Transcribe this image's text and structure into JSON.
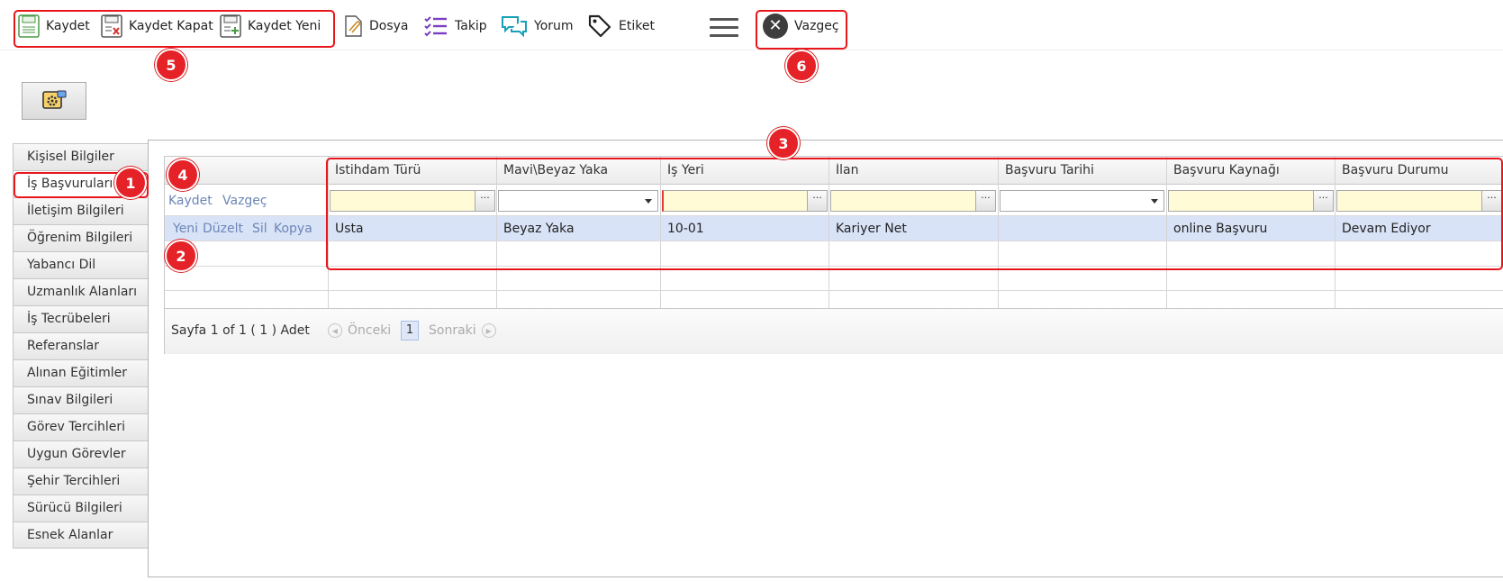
{
  "toolbar": {
    "save": "Kaydet",
    "save_close": "Kaydet Kapat",
    "save_new": "Kaydet Yeni",
    "file": "Dosya",
    "follow": "Takip",
    "comment": "Yorum",
    "tag": "Etiket",
    "cancel": "Vazgeç"
  },
  "sidebar": {
    "items": [
      {
        "label": "Kişisel Bilgiler"
      },
      {
        "label": "İş Başvuruları"
      },
      {
        "label": "İletişim Bilgileri"
      },
      {
        "label": "Öğrenim Bilgileri"
      },
      {
        "label": "Yabancı Dil"
      },
      {
        "label": "Uzmanlık Alanları"
      },
      {
        "label": "İş Tecrübeleri"
      },
      {
        "label": "Referanslar"
      },
      {
        "label": "Alınan Eğitimler"
      },
      {
        "label": "Sınav Bilgileri"
      },
      {
        "label": "Görev Tercihleri"
      },
      {
        "label": "Uygun Görevler"
      },
      {
        "label": "Şehir Tercihleri"
      },
      {
        "label": "Sürücü Bilgileri"
      },
      {
        "label": "Esnek Alanlar"
      }
    ],
    "active_index": 1
  },
  "grid": {
    "columns": [
      "İstihdam Türü",
      "Mavi\\Beyaz Yaka",
      "İş Yeri",
      "İlan",
      "Başvuru Tarihi",
      "Başvuru Kaynağı",
      "Başvuru Durumu"
    ],
    "edit_actions": {
      "save": "Kaydet",
      "cancel": "Vazgeç"
    },
    "row_actions": {
      "new": "Yeni",
      "edit": "Düzelt",
      "delete": "Sil",
      "copy": "Kopya"
    },
    "rows": [
      [
        "Usta",
        "Beyaz Yaka",
        "10-01",
        "Kariyer Net",
        "",
        "online Başvuru",
        "Devam Ediyor"
      ]
    ],
    "ellipsis": "···"
  },
  "pager": {
    "info": "Sayfa 1 of 1 ( 1 ) Adet",
    "prev": "Önceki",
    "page": "1",
    "next": "Sonraki"
  },
  "badges": {
    "b1": "1",
    "b2": "2",
    "b3": "3",
    "b4": "4",
    "b5": "5",
    "b6": "6"
  }
}
